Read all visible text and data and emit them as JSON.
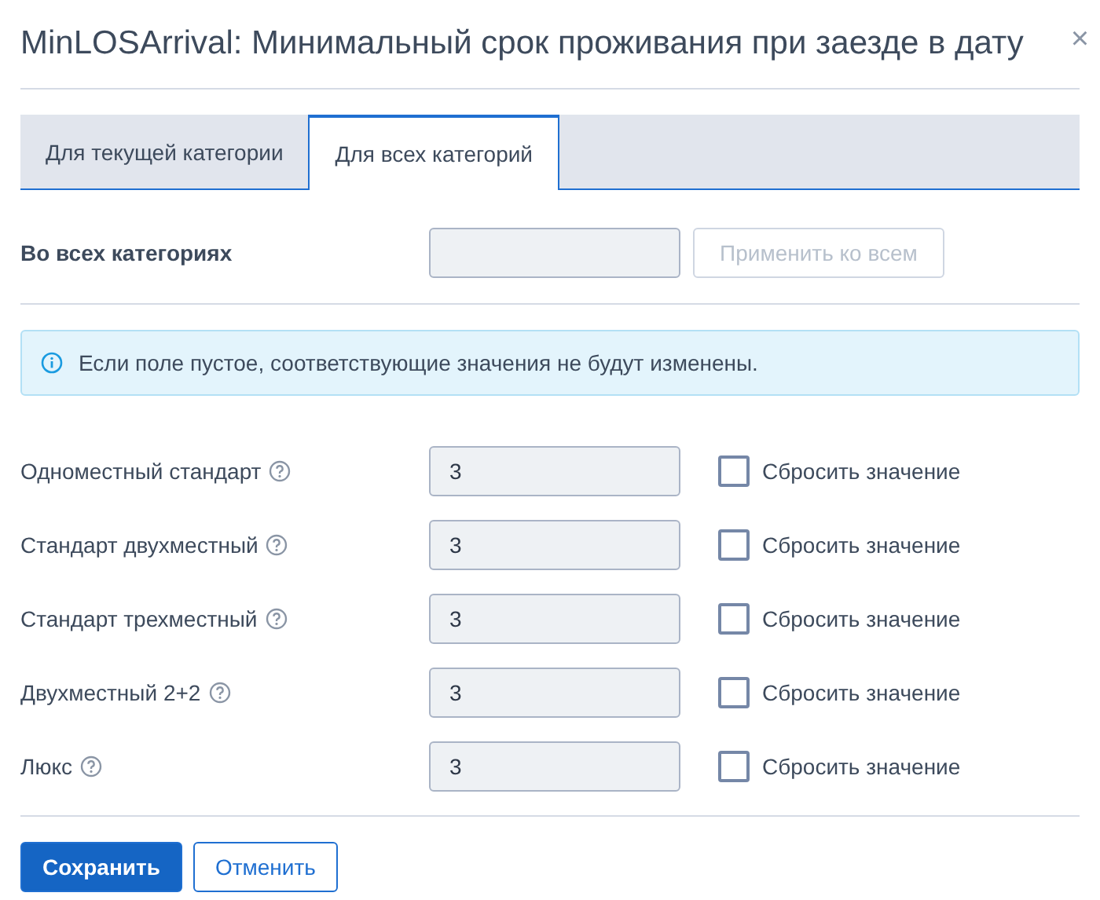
{
  "window": {
    "title": "MinLOSArrival: Минимальный срок проживания при заезде в дату",
    "close": "×"
  },
  "tabs": [
    {
      "label": "Для текущей категории",
      "selected": false
    },
    {
      "label": "Для всех категорий",
      "selected": true
    }
  ],
  "all_categories": {
    "label": "Во всех категориях",
    "apply_button": {
      "label": "Применить ко всем",
      "disabled": true
    }
  },
  "info": "Если поле пустое, соответствующие значения не будут изменены.",
  "rows": [
    {
      "name": "Одноместный стандарт",
      "value": "3",
      "reset_label": "Сбросить значение",
      "checked": false
    },
    {
      "name": "Стандарт двухместный",
      "value": "3",
      "reset_label": "Сбросить значение",
      "checked": false
    },
    {
      "name": "Стандарт трехместный",
      "value": "3",
      "reset_label": "Сбросить значение",
      "checked": false
    },
    {
      "name": "Двухместный 2+2",
      "value": "3",
      "reset_label": "Сбросить значение",
      "checked": false
    },
    {
      "name": "Люкс",
      "value": "3",
      "reset_label": "Сбросить значение",
      "checked": false
    }
  ],
  "buttons": [
    {
      "label": "Сохранить",
      "kind": "primary"
    },
    {
      "label": "Отменить",
      "kind": "secondary"
    }
  ]
}
